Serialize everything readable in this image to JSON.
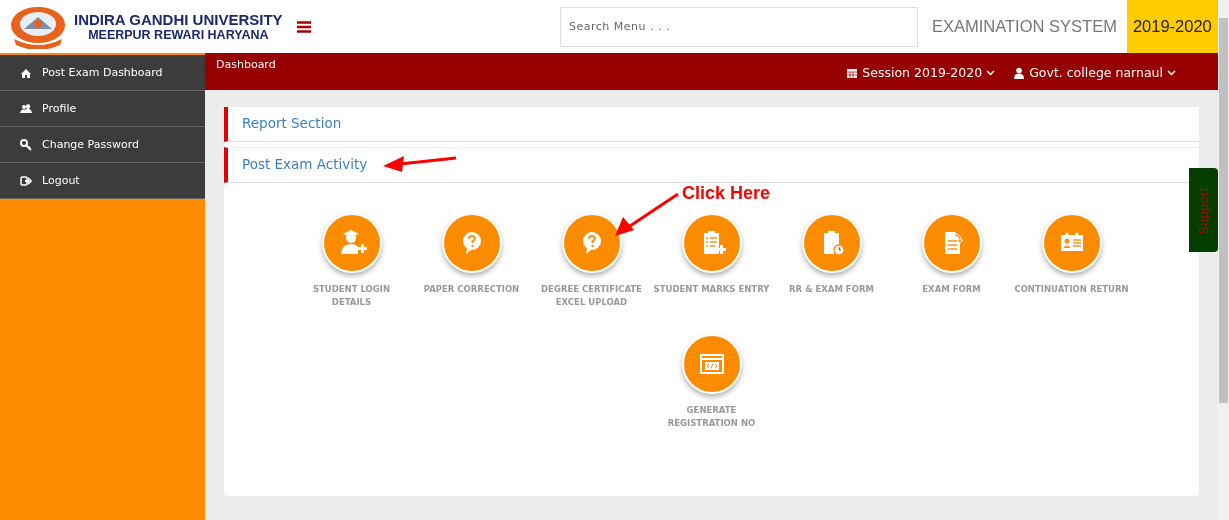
{
  "header": {
    "university_name": "INDIRA GANDHI UNIVERSITY",
    "university_location": "MEERPUR REWARI HARYANA",
    "search": {
      "placeholder": "Search Menu . . ."
    },
    "system_title": "EXAMINATION SYSTEM",
    "year_badge": "2019-2020"
  },
  "sidebar": {
    "items": [
      {
        "label": "Post Exam Dashboard"
      },
      {
        "label": "Profile"
      },
      {
        "label": "Change Password"
      },
      {
        "label": "Logout"
      }
    ]
  },
  "topbar": {
    "breadcrumb": "Dashboard",
    "session_label": "Session",
    "session_value": "2019-2020",
    "user": "Govt. college narnaul"
  },
  "sections": [
    {
      "title": "Report Section"
    },
    {
      "title": "Post Exam Activity"
    }
  ],
  "tiles": [
    {
      "label": "STUDENT LOGIN DETAILS"
    },
    {
      "label": "PAPER CORRECTION"
    },
    {
      "label": "DEGREE CERTIFICATE EXCEL UPLOAD"
    },
    {
      "label": "STUDENT MARKS ENTRY"
    },
    {
      "label": "RR & EXAM FORM"
    },
    {
      "label": "EXAM FORM"
    },
    {
      "label": "CONTINUATION RETURN"
    },
    {
      "label": "GENERATE REGISTRATION NO"
    }
  ],
  "support_tab": "Support",
  "annotation": {
    "text": "Click Here"
  }
}
